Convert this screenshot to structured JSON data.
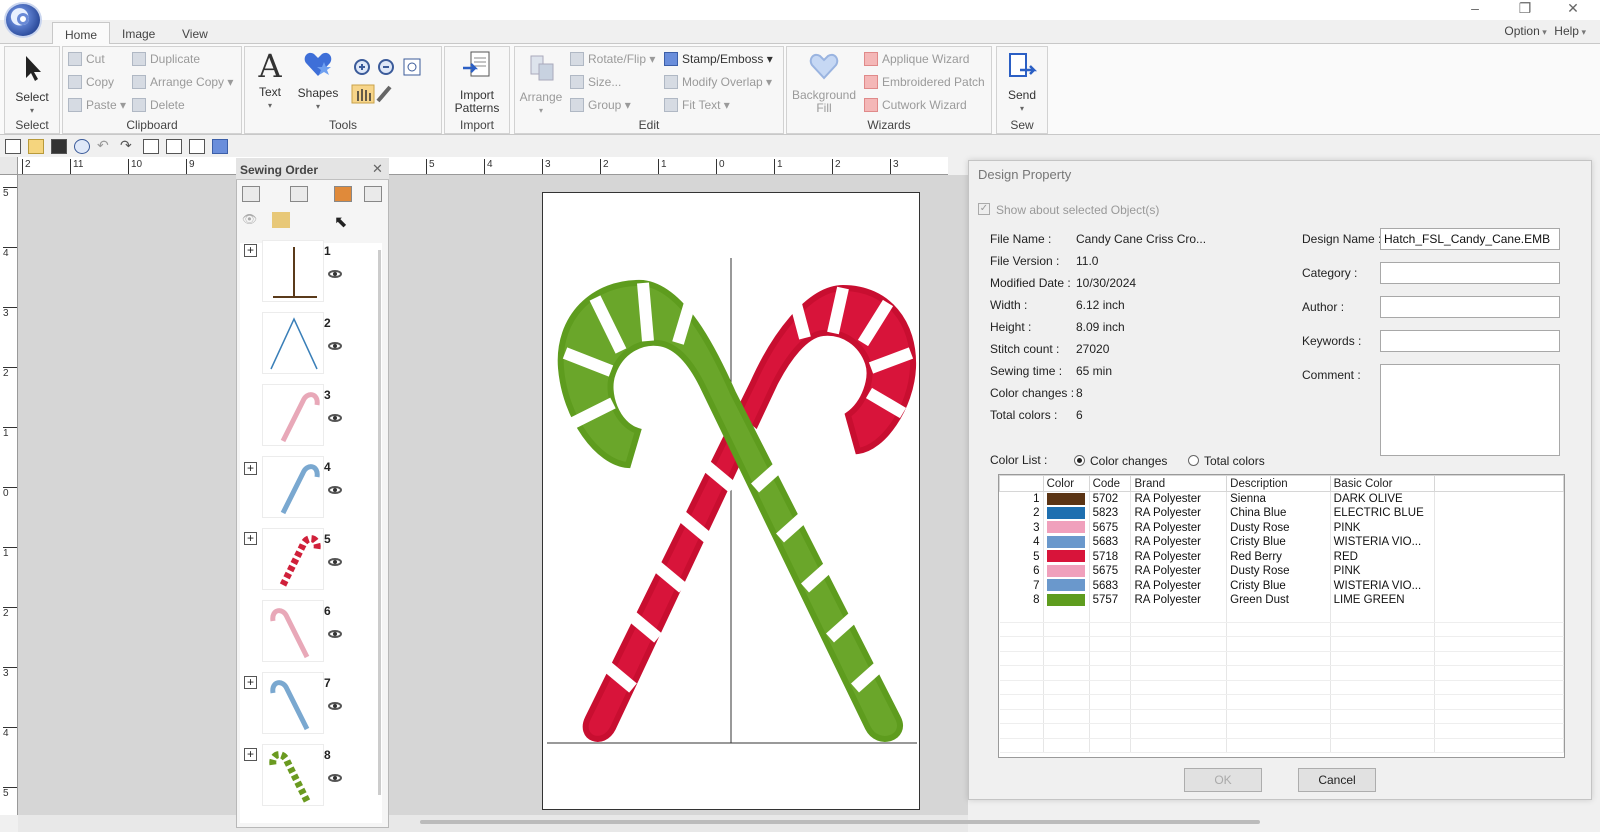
{
  "window": {
    "minimize": "–",
    "restore": "❐",
    "close": "✕"
  },
  "tabs": [
    {
      "label": "Home"
    },
    {
      "label": "Image"
    },
    {
      "label": "View"
    }
  ],
  "menu_right": {
    "option": "Option",
    "help": "Help"
  },
  "ribbon": {
    "select": {
      "button": "Select",
      "group": "Select"
    },
    "clipboard": {
      "group": "Clipboard",
      "cut": "Cut",
      "copy": "Copy",
      "paste": "Paste",
      "duplicate": "Duplicate",
      "arrange_copy": "Arrange Copy",
      "delete": "Delete"
    },
    "tools": {
      "group": "Tools",
      "text": "Text",
      "shapes": "Shapes"
    },
    "import": {
      "group": "Import",
      "import_patterns": "Import Patterns"
    },
    "edit": {
      "group": "Edit",
      "arrange": "Arrange",
      "rotate_flip": "Rotate/Flip",
      "size": "Size...",
      "group_btn": "Group",
      "stamp_emboss": "Stamp/Emboss",
      "modify_overlap": "Modify Overlap",
      "fit_text": "Fit Text"
    },
    "wizards": {
      "group": "Wizards",
      "background_fill": "Background Fill",
      "applique_wizard": "Applique Wizard",
      "embroidered_patch": "Embroidered Patch",
      "cutwork_wizard": "Cutwork Wizard"
    },
    "sew": {
      "group": "Sew",
      "send": "Send"
    }
  },
  "ruler_top": [
    "2",
    "11",
    "10",
    "9",
    "5",
    "4",
    "3",
    "2",
    "1",
    "0",
    "1",
    "2",
    "3"
  ],
  "ruler_left": [
    "5",
    "4",
    "3",
    "2",
    "1",
    "0",
    "1",
    "2",
    "3",
    "4",
    "5"
  ],
  "sewing_order": {
    "title": "Sewing Order",
    "items": [
      {
        "num": "1",
        "expandable": true,
        "color": "#5a3a1a"
      },
      {
        "num": "2",
        "expandable": false,
        "color": "#3a7fb8"
      },
      {
        "num": "3",
        "expandable": false,
        "color": "#e8a8b8"
      },
      {
        "num": "4",
        "expandable": true,
        "color": "#7aa8d0"
      },
      {
        "num": "5",
        "expandable": true,
        "color": "#d0203a"
      },
      {
        "num": "6",
        "expandable": false,
        "color": "#e8a8b8"
      },
      {
        "num": "7",
        "expandable": true,
        "color": "#7aa8d0"
      },
      {
        "num": "8",
        "expandable": true,
        "color": "#6a9a20"
      }
    ]
  },
  "design_property": {
    "title": "Design Property",
    "show_selected": "Show about selected Object(s)",
    "fields": [
      {
        "label": "File Name :",
        "value": "Candy Cane Criss Cro..."
      },
      {
        "label": "File Version :",
        "value": "11.0"
      },
      {
        "label": "Modified Date :",
        "value": "10/30/2024"
      },
      {
        "label": "Width :",
        "value": "6.12 inch"
      },
      {
        "label": "Height :",
        "value": "8.09 inch"
      },
      {
        "label": "Stitch count :",
        "value": "27020"
      },
      {
        "label": "Sewing time :",
        "value": "65 min"
      },
      {
        "label": "Color changes :",
        "value": "8"
      },
      {
        "label": "Total colors :",
        "value": "6"
      }
    ],
    "design_name_label": "Design Name :",
    "design_name": "Hatch_FSL_Candy_Cane.EMB",
    "category_label": "Category :",
    "author_label": "Author :",
    "keywords_label": "Keywords :",
    "comment_label": "Comment :",
    "color_list_label": "Color List :",
    "radio_color_changes": "Color changes",
    "radio_total_colors": "Total colors",
    "columns": [
      "",
      "Color",
      "Code",
      "Brand",
      "Description",
      "Basic Color"
    ],
    "rows": [
      {
        "n": "1",
        "hex": "#5b3414",
        "code": "5702",
        "brand": "RA Polyester",
        "desc": "Sienna",
        "basic": "DARK OLIVE"
      },
      {
        "n": "2",
        "hex": "#1e6fb0",
        "code": "5823",
        "brand": "RA Polyester",
        "desc": "China Blue",
        "basic": "ELECTRIC BLUE"
      },
      {
        "n": "3",
        "hex": "#f0a0bc",
        "code": "5675",
        "brand": "RA Polyester",
        "desc": "Dusty Rose",
        "basic": "PINK"
      },
      {
        "n": "4",
        "hex": "#6a98cc",
        "code": "5683",
        "brand": "RA Polyester",
        "desc": "Cristy Blue",
        "basic": "WISTERIA VIO..."
      },
      {
        "n": "5",
        "hex": "#d8143a",
        "code": "5718",
        "brand": "RA Polyester",
        "desc": "Red Berry",
        "basic": "RED"
      },
      {
        "n": "6",
        "hex": "#f0a0bc",
        "code": "5675",
        "brand": "RA Polyester",
        "desc": "Dusty Rose",
        "basic": "PINK"
      },
      {
        "n": "7",
        "hex": "#6a98cc",
        "code": "5683",
        "brand": "RA Polyester",
        "desc": "Cristy Blue",
        "basic": "WISTERIA VIO..."
      },
      {
        "n": "8",
        "hex": "#5e9c1e",
        "code": "5757",
        "brand": "RA Polyester",
        "desc": "Green Dust",
        "basic": "LIME GREEN"
      }
    ],
    "ok": "OK",
    "cancel": "Cancel"
  }
}
